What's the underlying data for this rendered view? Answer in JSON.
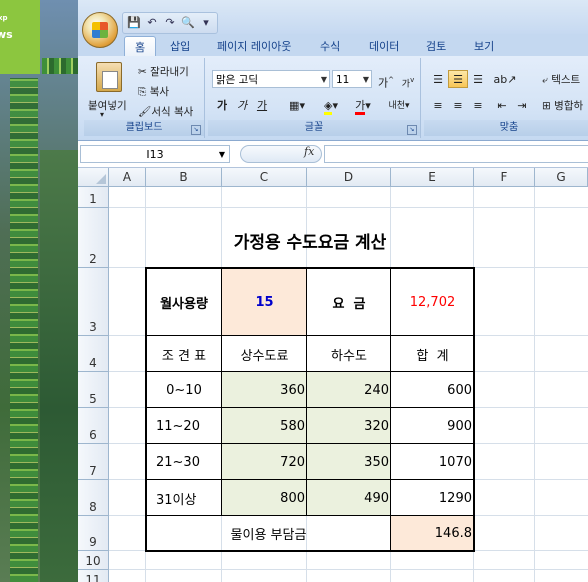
{
  "desktop": {
    "logo_text": "ws",
    "logo_sup": "xp"
  },
  "ribbon": {
    "tabs": [
      "홈",
      "삽입",
      "페이지 레이아웃",
      "수식",
      "데이터",
      "검토",
      "보기"
    ],
    "clipboard": {
      "paste": "붙여넣기",
      "cut": "잘라내기",
      "copy": "복사",
      "format_painter": "서식 복사",
      "label": "클립보드"
    },
    "font": {
      "name": "맑은 고딕",
      "size": "11",
      "label": "글꼴",
      "bold": "가",
      "italic": "가",
      "underline": "가",
      "grow": "가",
      "shrink": "가",
      "color": "가",
      "phonetic": "내천"
    },
    "alignment": {
      "label": "맞춤",
      "wrap": "텍스트",
      "merge": "병합하"
    }
  },
  "formula_bar": {
    "name_box": "I13",
    "fx": "fx",
    "value": ""
  },
  "columns": [
    "A",
    "B",
    "C",
    "D",
    "E",
    "F",
    "G"
  ],
  "rows": [
    "1",
    "2",
    "3",
    "4",
    "5",
    "6",
    "7",
    "8",
    "9",
    "10",
    "11"
  ],
  "sheet": {
    "title": "가정용 수도요금 계산",
    "usage_label": "월사용량",
    "usage_value": "15",
    "fee_label": "요  금",
    "fee_value": "12,702",
    "headers": [
      "조 견 표",
      "상수도료",
      "하수도",
      "합  계"
    ],
    "table": [
      {
        "range": "0~10",
        "water": "360",
        "sewer": "240",
        "total": "600"
      },
      {
        "range": "11~20",
        "water": "580",
        "sewer": "320",
        "total": "900"
      },
      {
        "range": "21~30",
        "water": "720",
        "sewer": "350",
        "total": "1070"
      },
      {
        "range": "31이상",
        "water": "800",
        "sewer": "490",
        "total": "1290"
      }
    ],
    "levy_label": "물이용 부담금",
    "levy_value": "146.8"
  },
  "colors": {
    "accent": "#15428b",
    "usage_text": "#0000cc",
    "fee_text": "#ff0000",
    "green_fill": "#ebf1de",
    "peach_fill": "#fde9d9"
  }
}
